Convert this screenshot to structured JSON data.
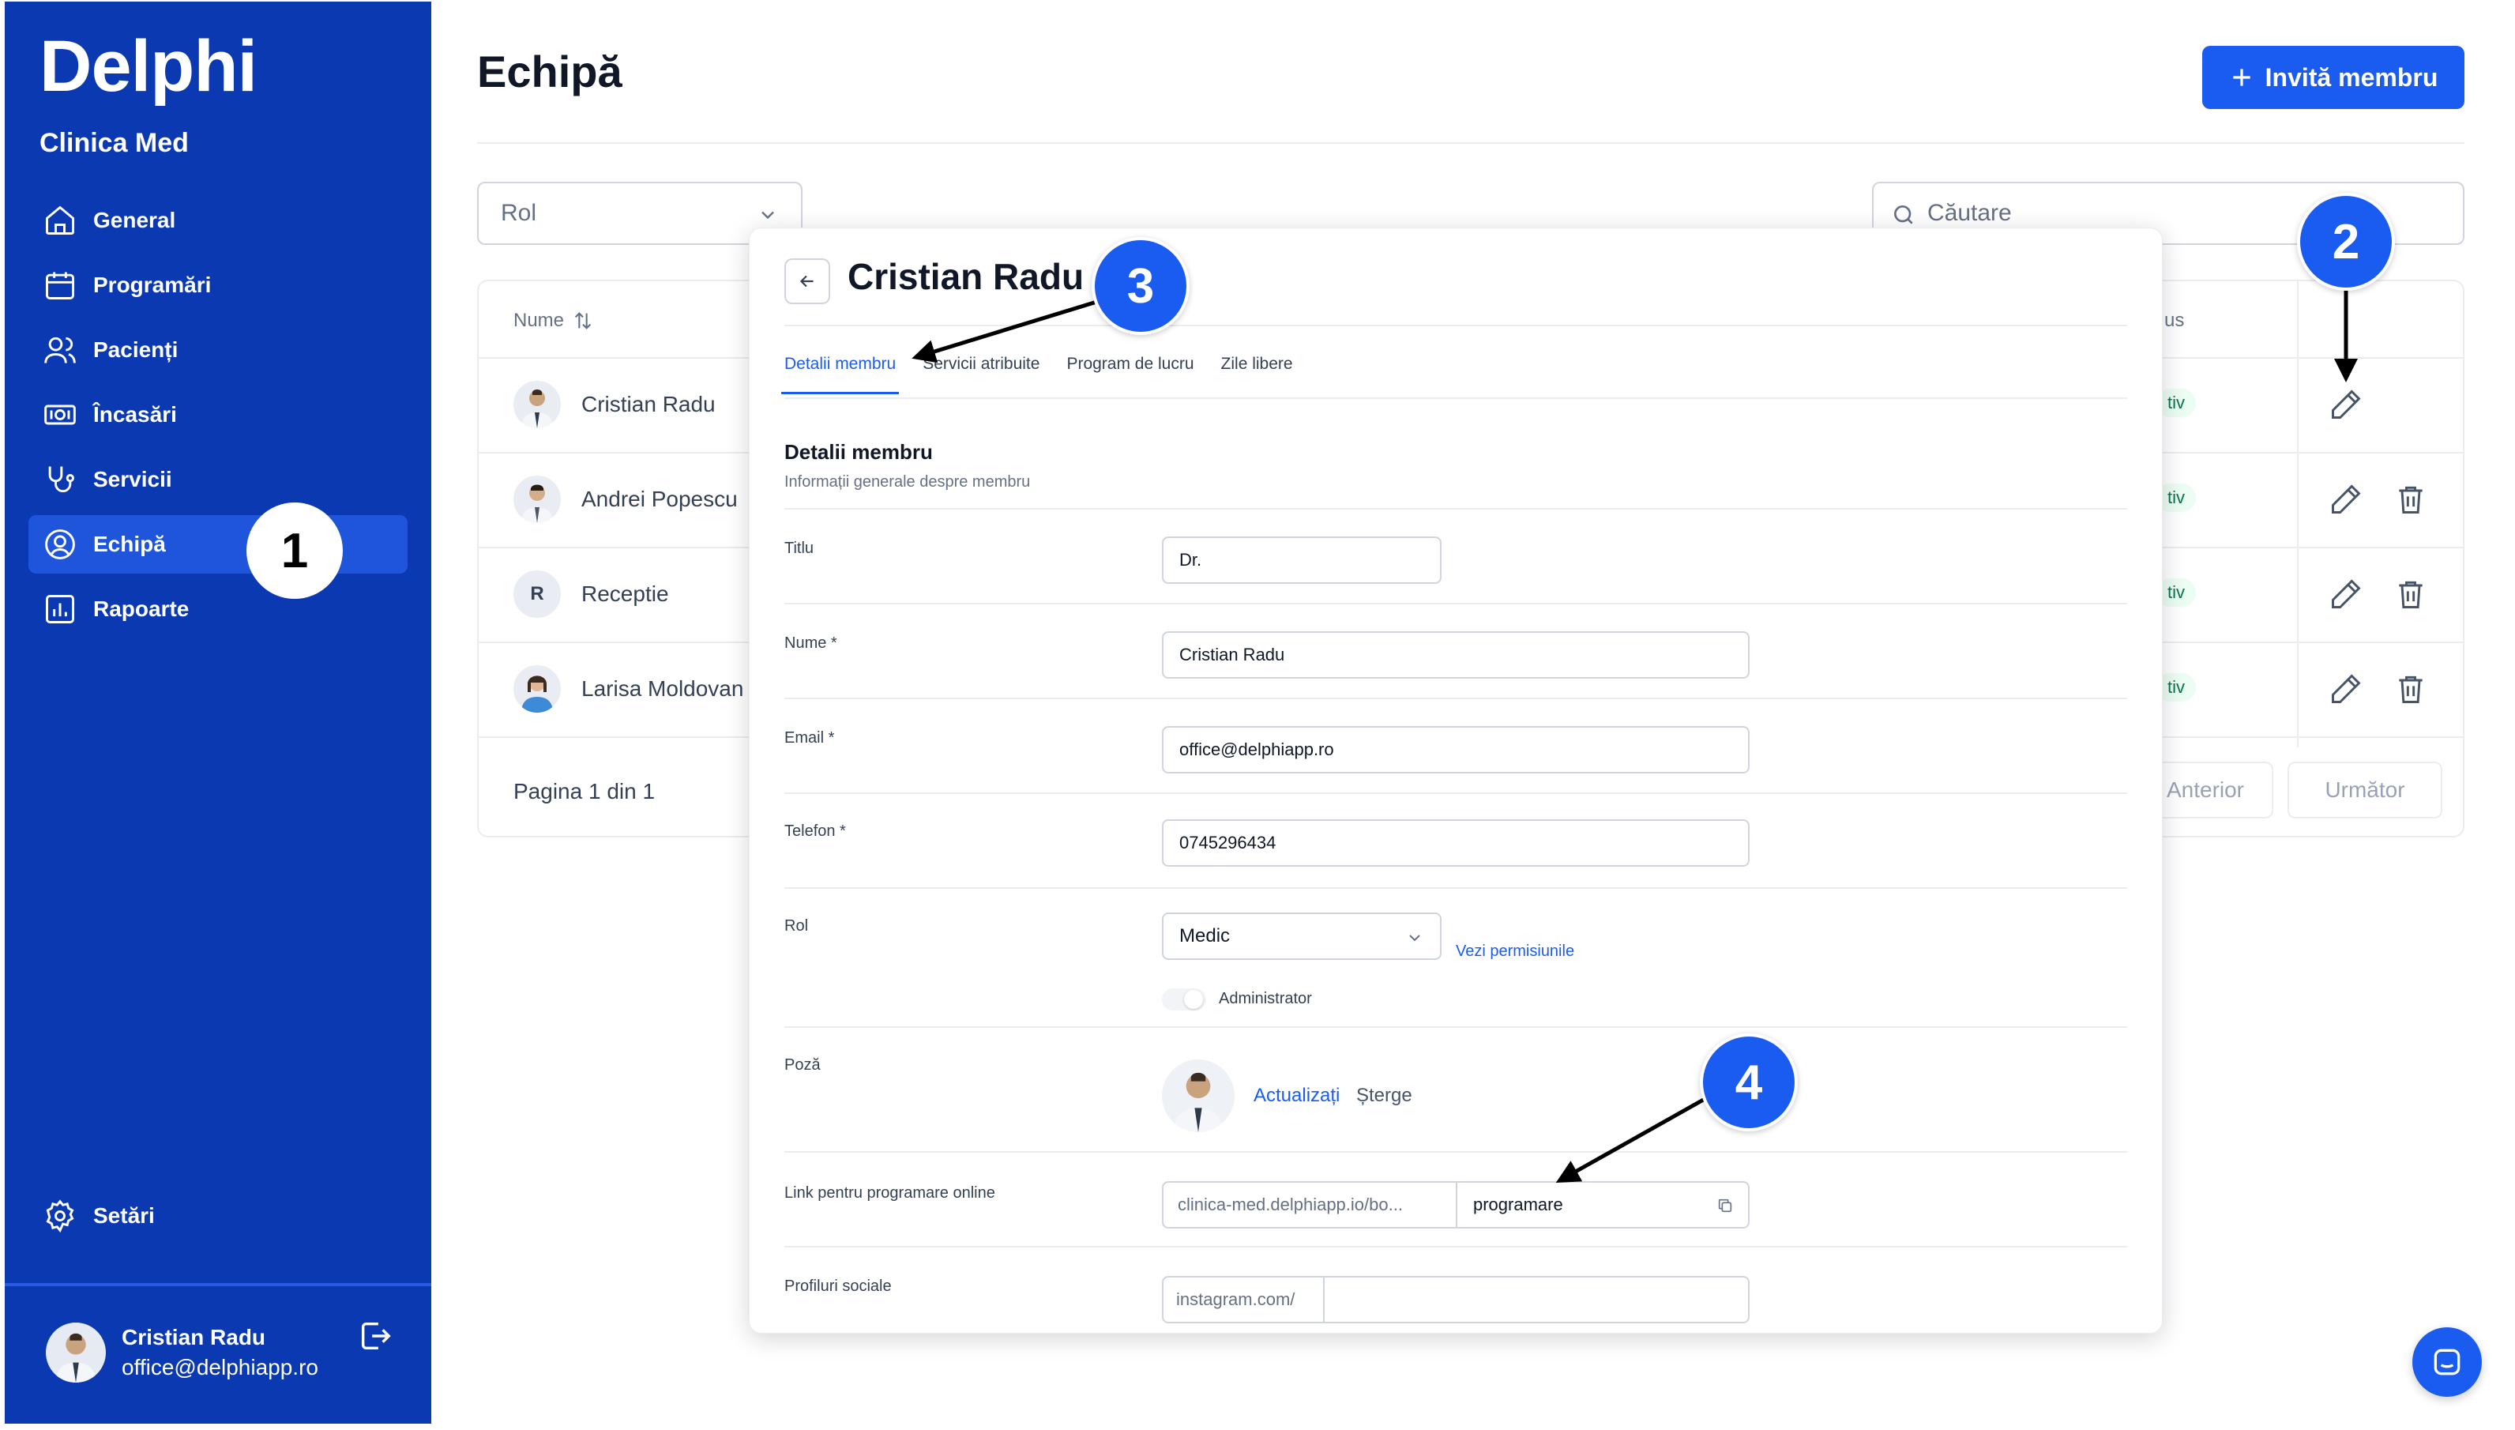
{
  "app": {
    "logo": "Delphi",
    "clinic": "Clinica Med"
  },
  "sidebar": {
    "items": [
      {
        "label": "General",
        "icon": "home-icon"
      },
      {
        "label": "Programări",
        "icon": "calendar-icon"
      },
      {
        "label": "Pacienți",
        "icon": "users-icon"
      },
      {
        "label": "Încasări",
        "icon": "cash-icon"
      },
      {
        "label": "Servicii",
        "icon": "stethoscope-icon"
      },
      {
        "label": "Echipă",
        "icon": "user-circle-icon",
        "active": true
      },
      {
        "label": "Rapoarte",
        "icon": "chart-icon"
      }
    ],
    "settings": "Setări",
    "user": {
      "name": "Cristian Radu",
      "email": "office@delphiapp.ro"
    }
  },
  "main": {
    "title": "Echipă",
    "invite_button": "Invită membru",
    "filter_role_placeholder": "Rol",
    "search_placeholder": "Căutare",
    "table": {
      "col_name": "Nume",
      "col_status": "us",
      "rows": [
        {
          "name": "Cristian Radu",
          "status": "tiv",
          "initial": ""
        },
        {
          "name": "Andrei Popescu",
          "status": "tiv",
          "initial": ""
        },
        {
          "name": "Receptie",
          "status": "tiv",
          "initial": "R"
        },
        {
          "name": "Larisa Moldovan",
          "status": "tiv",
          "initial": ""
        }
      ],
      "pagination": "Pagina 1 din 1",
      "prev": "Anterior",
      "next": "Următor"
    }
  },
  "panel": {
    "title": "Cristian Radu",
    "tabs": [
      "Detalii membru",
      "Servicii atribuite",
      "Program de lucru",
      "Zile libere"
    ],
    "section_title": "Detalii membru",
    "section_subtitle": "Informații generale despre membru",
    "fields": {
      "title_label": "Titlu",
      "title_value": "Dr.",
      "name_label": "Nume *",
      "name_value": "Cristian Radu",
      "email_label": "Email *",
      "email_value": "office@delphiapp.ro",
      "phone_label": "Telefon *",
      "phone_value": "0745296434",
      "role_label": "Rol",
      "role_value": "Medic",
      "role_link": "Vezi permisiunile",
      "admin_label": "Administrator",
      "photo_label": "Poză",
      "photo_update": "Actualizați",
      "photo_delete": "Șterge",
      "link_label": "Link pentru programare online",
      "link_prefix": "clinica-med.delphiapp.io/bo...",
      "link_slug": "programare",
      "social_label": "Profiluri sociale",
      "social_prefix": "instagram.com/"
    }
  },
  "markers": [
    "1",
    "2",
    "3",
    "4"
  ],
  "colors": {
    "sidebar": "#0a39b1",
    "accent": "#1b5cf0",
    "active_nav": "#1f55db"
  }
}
